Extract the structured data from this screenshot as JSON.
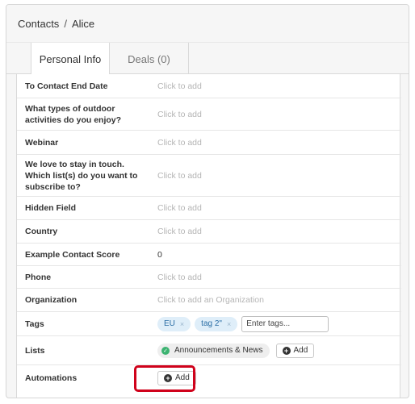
{
  "breadcrumb": {
    "root": "Contacts",
    "separator": "/",
    "current": "Alice"
  },
  "tabs": [
    {
      "label": "Personal Info",
      "active": true
    },
    {
      "label": "Deals (0)",
      "active": false
    }
  ],
  "fields": [
    {
      "label": "To Contact End Date",
      "value": "Click to add"
    },
    {
      "label": "What types of outdoor activities do you enjoy?",
      "value": "Click to add"
    },
    {
      "label": "Webinar",
      "value": "Click to add"
    },
    {
      "label": "We love to stay in touch. Which list(s) do you want to subscribe to?",
      "value": "Click to add"
    },
    {
      "label": "Hidden Field",
      "value": "Click to add"
    },
    {
      "label": "Country",
      "value": "Click to add"
    },
    {
      "label": "Example Contact Score",
      "value": "0"
    },
    {
      "label": "Phone",
      "value": "Click to add"
    },
    {
      "label": "Organization",
      "value": "Click to add an Organization"
    }
  ],
  "tags": {
    "label": "Tags",
    "items": [
      "EU",
      "tag 2\""
    ],
    "remove_glyph": "×",
    "input_placeholder": "Enter tags..."
  },
  "lists": {
    "label": "Lists",
    "items": [
      "Announcements & News"
    ],
    "add_label": "Add"
  },
  "automations": {
    "label": "Automations",
    "add_label": "Add"
  },
  "colors": {
    "highlight": "#d0021b",
    "tag_bg": "#dfeef9",
    "tag_text": "#2b6ea5",
    "check": "#3cb371"
  }
}
